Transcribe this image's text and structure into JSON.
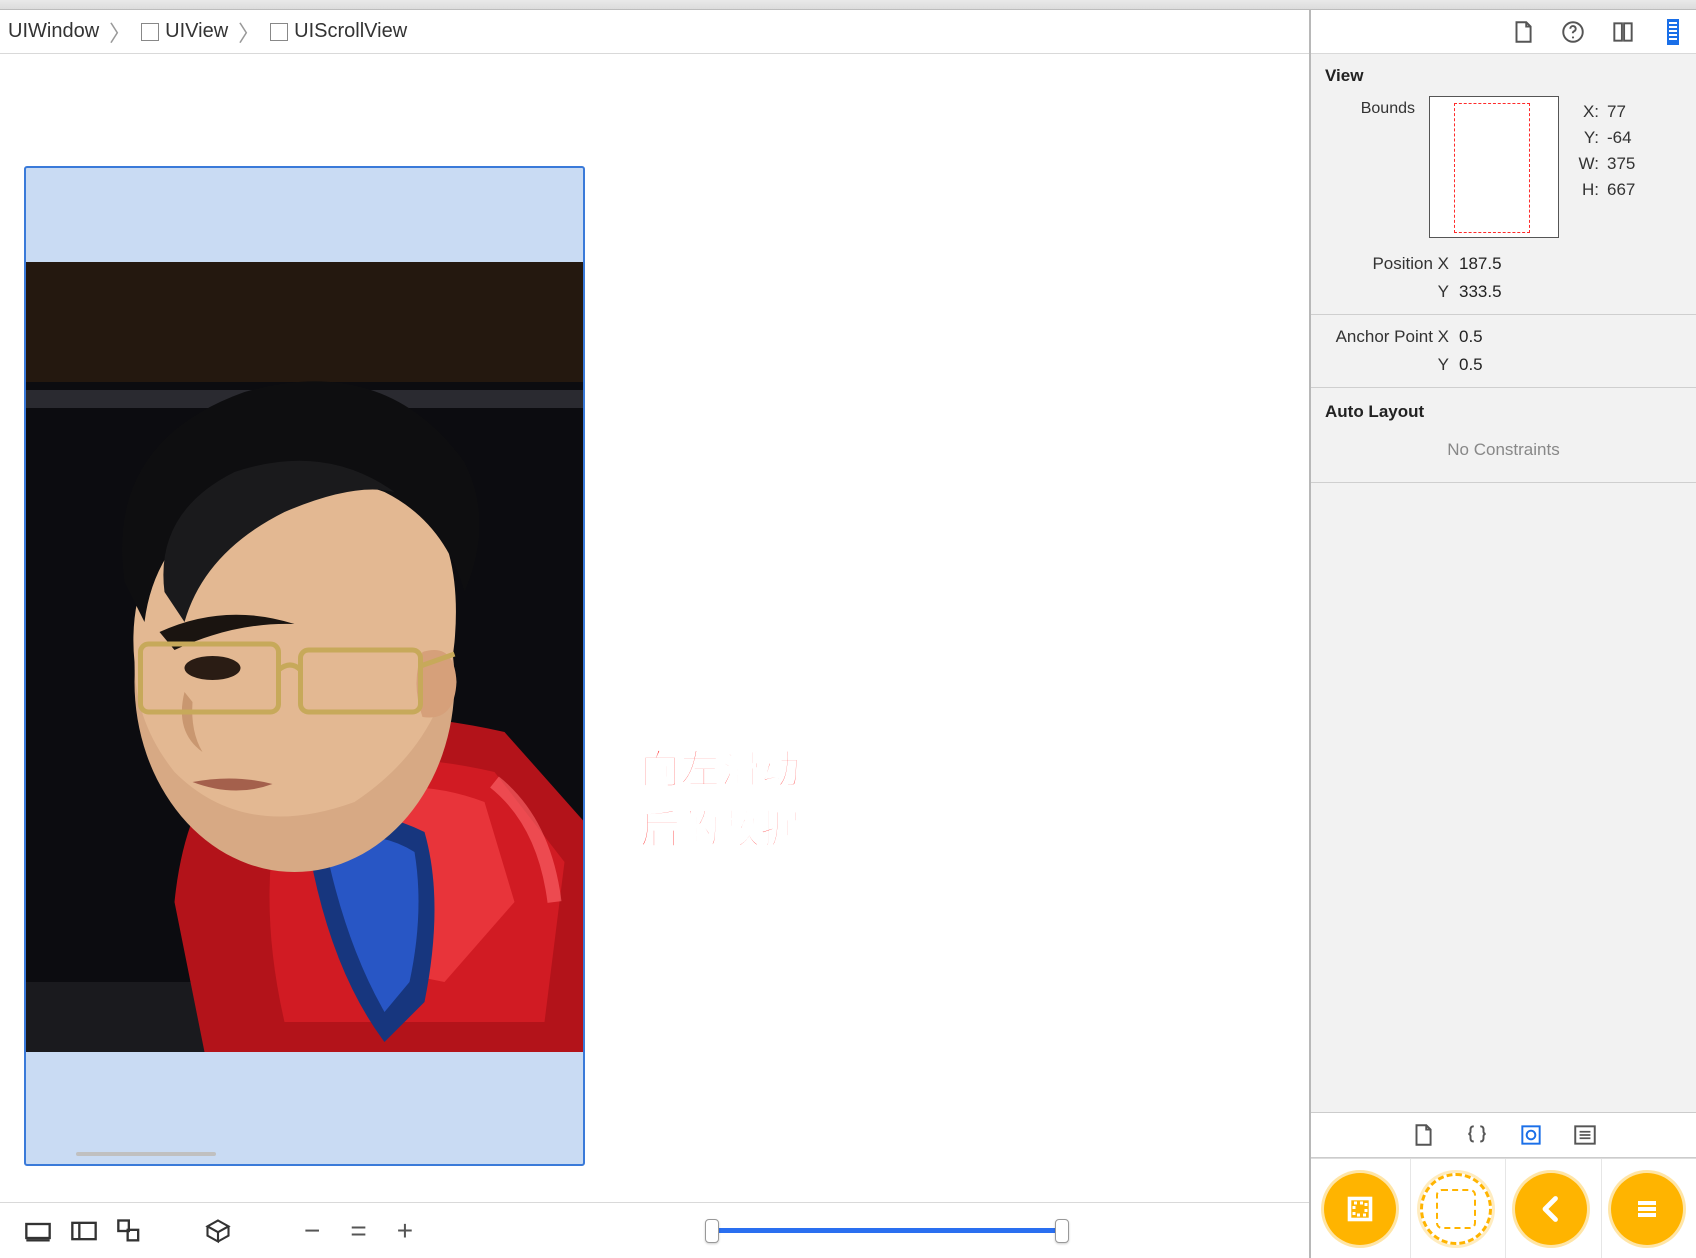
{
  "breadcrumb": [
    {
      "label": "UIWindow",
      "hasIcon": false
    },
    {
      "label": "UIView",
      "hasIcon": true
    },
    {
      "label": "UIScrollView",
      "hasIcon": true
    }
  ],
  "annotation": {
    "line1": "向左滑动",
    "line2": "后的数据"
  },
  "inspector": {
    "section_view": "View",
    "bounds_label": "Bounds",
    "bounds": {
      "x": "77",
      "y": "-64",
      "w": "375",
      "h": "667"
    },
    "bounds_keys": {
      "x": "X:",
      "y": "Y:",
      "w": "W:",
      "h": "H:"
    },
    "position": {
      "label_x": "Position X",
      "label_y": "Y",
      "x": "187.5",
      "y": "333.5"
    },
    "anchor": {
      "label_x": "Anchor Point X",
      "label_y": "Y",
      "x": "0.5",
      "y": "0.5"
    },
    "auto_layout": "Auto Layout",
    "no_constraints": "No Constraints"
  },
  "toolbar": {
    "minus": "−",
    "equals": "=",
    "plus": "+"
  }
}
